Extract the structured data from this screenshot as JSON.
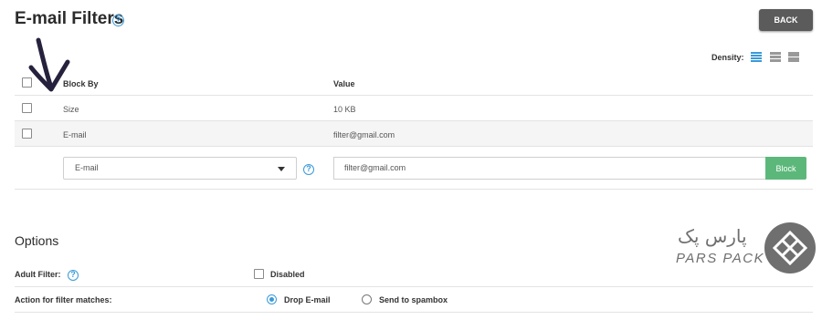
{
  "page": {
    "title": "E-mail Filters",
    "back_label": "BACK"
  },
  "density": {
    "label": "Density:",
    "active": "compact"
  },
  "table": {
    "headers": {
      "block_by": "Block By",
      "value": "Value"
    },
    "rows": [
      {
        "block_by": "Size",
        "value": "10 KB"
      },
      {
        "block_by": "E-mail",
        "value": "filter@gmail.com"
      }
    ],
    "new_row": {
      "select_value": "E-mail",
      "input_value": "filter@gmail.com",
      "block_label": "Block"
    }
  },
  "options": {
    "title": "Options",
    "adult_filter": {
      "label": "Adult Filter:",
      "checkbox_label": "Disabled",
      "checked": false
    },
    "action": {
      "label": "Action for filter matches:",
      "choices": [
        {
          "label": "Drop E-mail",
          "selected": true
        },
        {
          "label": "Send to spambox",
          "selected": false
        }
      ]
    }
  },
  "watermark": {
    "text_fa": "پارس پک",
    "text_en": "PARS PACK"
  },
  "colors": {
    "accent": "#3a9ad9",
    "block_button": "#5cb87a",
    "back_button": "#5b5b5b"
  }
}
